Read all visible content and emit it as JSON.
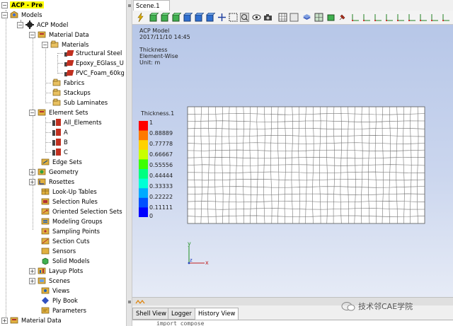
{
  "tree": {
    "root": "ACP - Pre",
    "models": "Models",
    "acp_model": "ACP Model",
    "material_data": "Material Data",
    "materials": "Materials",
    "materials_list": [
      "Structural Steel",
      "Epoxy_EGlass_U",
      "PVC_Foam_60kg"
    ],
    "fabrics": "Fabrics",
    "stackups": "Stackups",
    "sub_laminates": "Sub Laminates",
    "element_sets": "Element Sets",
    "element_sets_list": [
      "All_Elements",
      "A",
      "B",
      "C"
    ],
    "items": [
      "Edge Sets",
      "Geometry",
      "Rosettes",
      "Look-Up Tables",
      "Selection Rules",
      "Oriented Selection Sets",
      "Modeling Groups",
      "Sampling Points",
      "Section Cuts",
      "Sensors",
      "Solid Models",
      "Layup Plots",
      "Scenes",
      "Views",
      "Ply Book",
      "Parameters"
    ],
    "bottom_material_data": "Material Data"
  },
  "scene": {
    "tab_label": "Scene.1",
    "model_name": "ACP Model",
    "timestamp": "2017/11/10 14:45",
    "quantity": "Thickness",
    "mode": "Element-Wise",
    "unit": "Unit: m"
  },
  "legend": {
    "title": "Thickness.1",
    "labels": [
      "1",
      "0.88889",
      "0.77778",
      "0.66667",
      "0.55556",
      "0.44444",
      "0.33333",
      "0.22222",
      "0.11111",
      "0"
    ],
    "colors": [
      "#ff0000",
      "#ff7a00",
      "#ffd200",
      "#c8ff00",
      "#3cff00",
      "#00ff80",
      "#00ffd6",
      "#00aaff",
      "#0050ff",
      "#0000ff"
    ]
  },
  "axes": {
    "y": "y",
    "x": "x",
    "z": "z"
  },
  "bottom_tabs": {
    "shell": "Shell View",
    "logger": "Logger",
    "history": "History View"
  },
  "console": {
    "text": "import compose"
  },
  "watermark": {
    "text": "技术邻CAE学院"
  }
}
